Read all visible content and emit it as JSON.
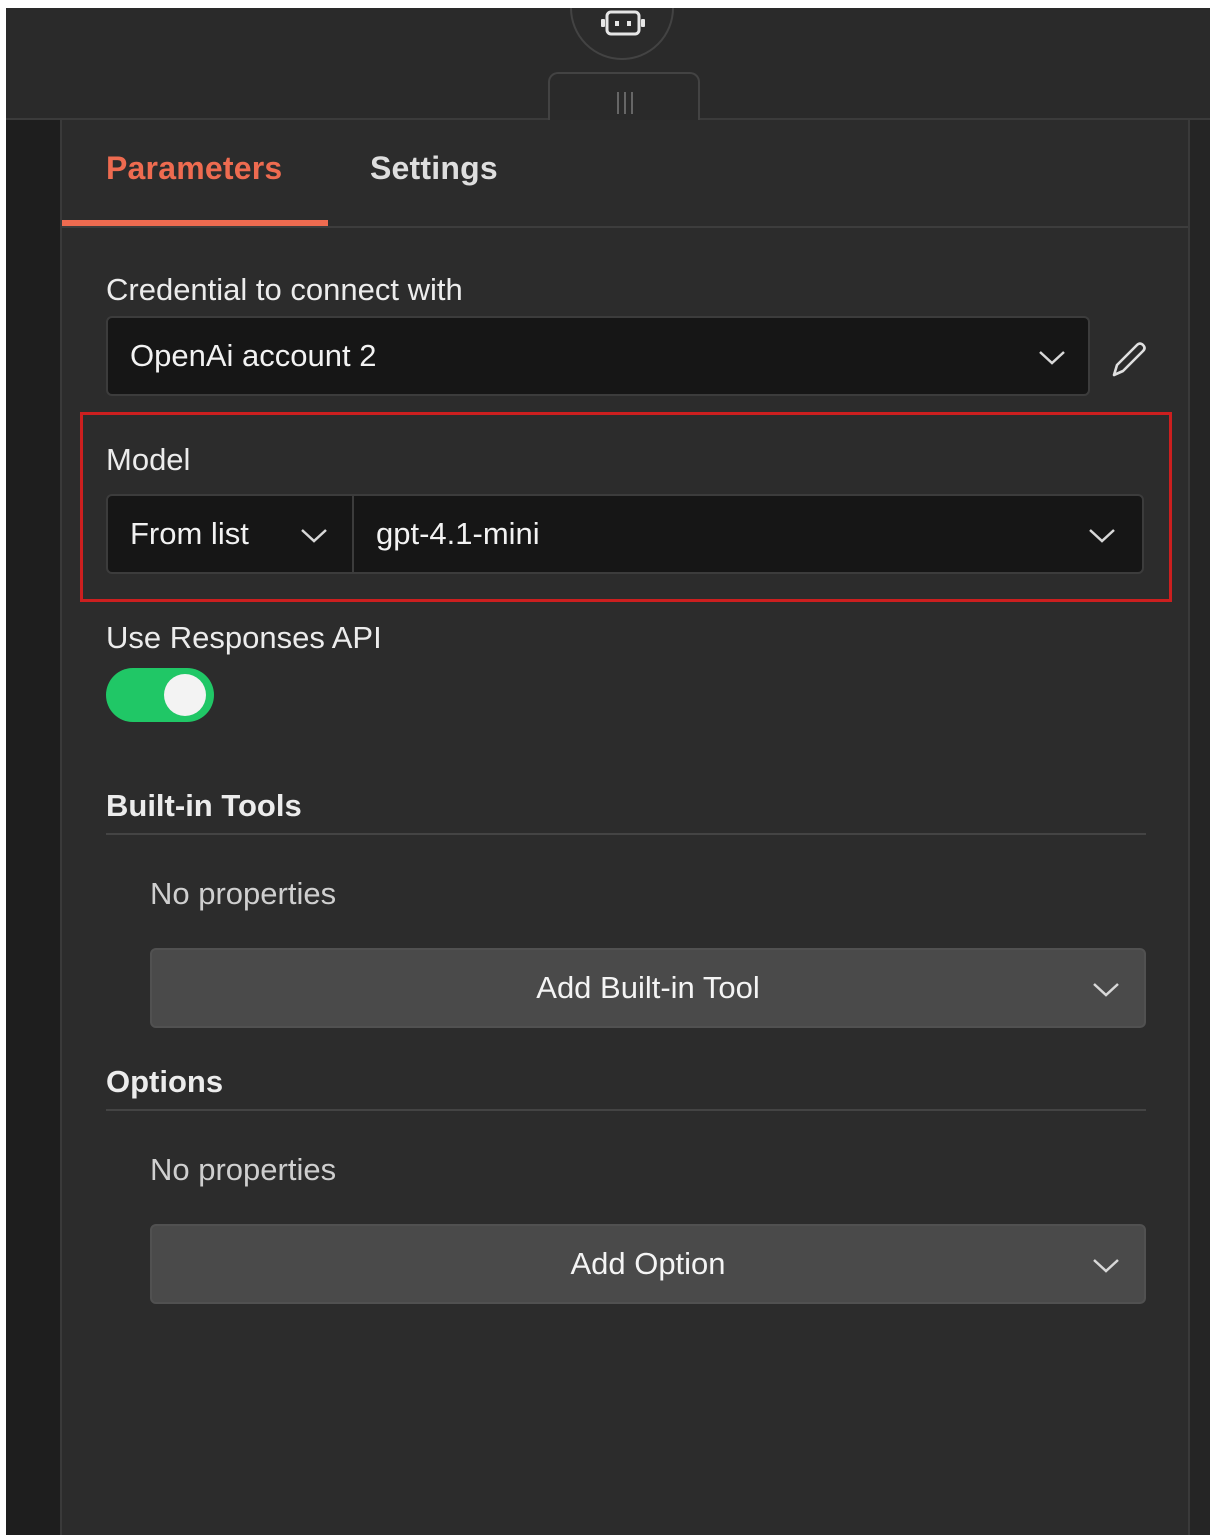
{
  "colors": {
    "accent": "#ee6b50",
    "toggle_on": "#20c766",
    "highlight": "#cc1f1f"
  },
  "tabs": [
    {
      "label": "Parameters",
      "active": true
    },
    {
      "label": "Settings",
      "active": false
    }
  ],
  "credential": {
    "label": "Credential to connect with",
    "value": "OpenAi account 2"
  },
  "model": {
    "label": "Model",
    "mode": "From list",
    "value": "gpt-4.1-mini"
  },
  "responses_api": {
    "label": "Use Responses API",
    "enabled": true
  },
  "builtin_tools": {
    "title": "Built-in Tools",
    "empty_text": "No properties",
    "add_label": "Add Built-in Tool"
  },
  "options": {
    "title": "Options",
    "empty_text": "No properties",
    "add_label": "Add Option"
  }
}
